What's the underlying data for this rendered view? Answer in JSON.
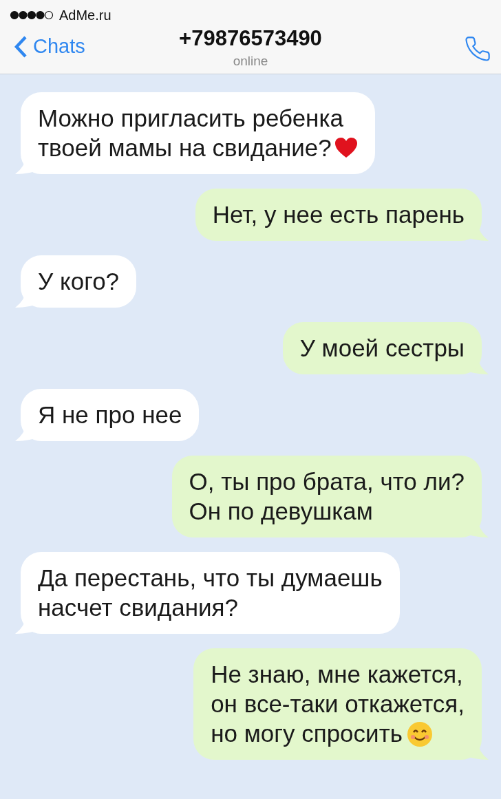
{
  "status_bar": {
    "carrier": "AdMe.ru"
  },
  "header": {
    "back": "Chats",
    "title": "+79876573490",
    "subtitle": "online"
  },
  "messages": [
    {
      "kind": "incoming",
      "text": "Можно пригласить ребенка\nтвоей мамы на свидание?",
      "emoji": {
        "kind": "heart"
      }
    },
    {
      "kind": "outgoing",
      "text": "Нет, у нее есть парень"
    },
    {
      "kind": "incoming",
      "text": "У кого?"
    },
    {
      "kind": "outgoing",
      "text": "У моей сестры"
    },
    {
      "kind": "incoming",
      "text": "Я не про нее"
    },
    {
      "kind": "outgoing",
      "text": "О, ты про брата, что ли?\nОн по девушкам"
    },
    {
      "kind": "incoming",
      "text": "Да перестань, что ты думаешь\nнасчет свидания?"
    },
    {
      "kind": "outgoing",
      "text": "Не знаю, мне кажется,\nон все-таки откажется,\nно могу спросить",
      "emoji": {
        "kind": "smile"
      }
    }
  ]
}
